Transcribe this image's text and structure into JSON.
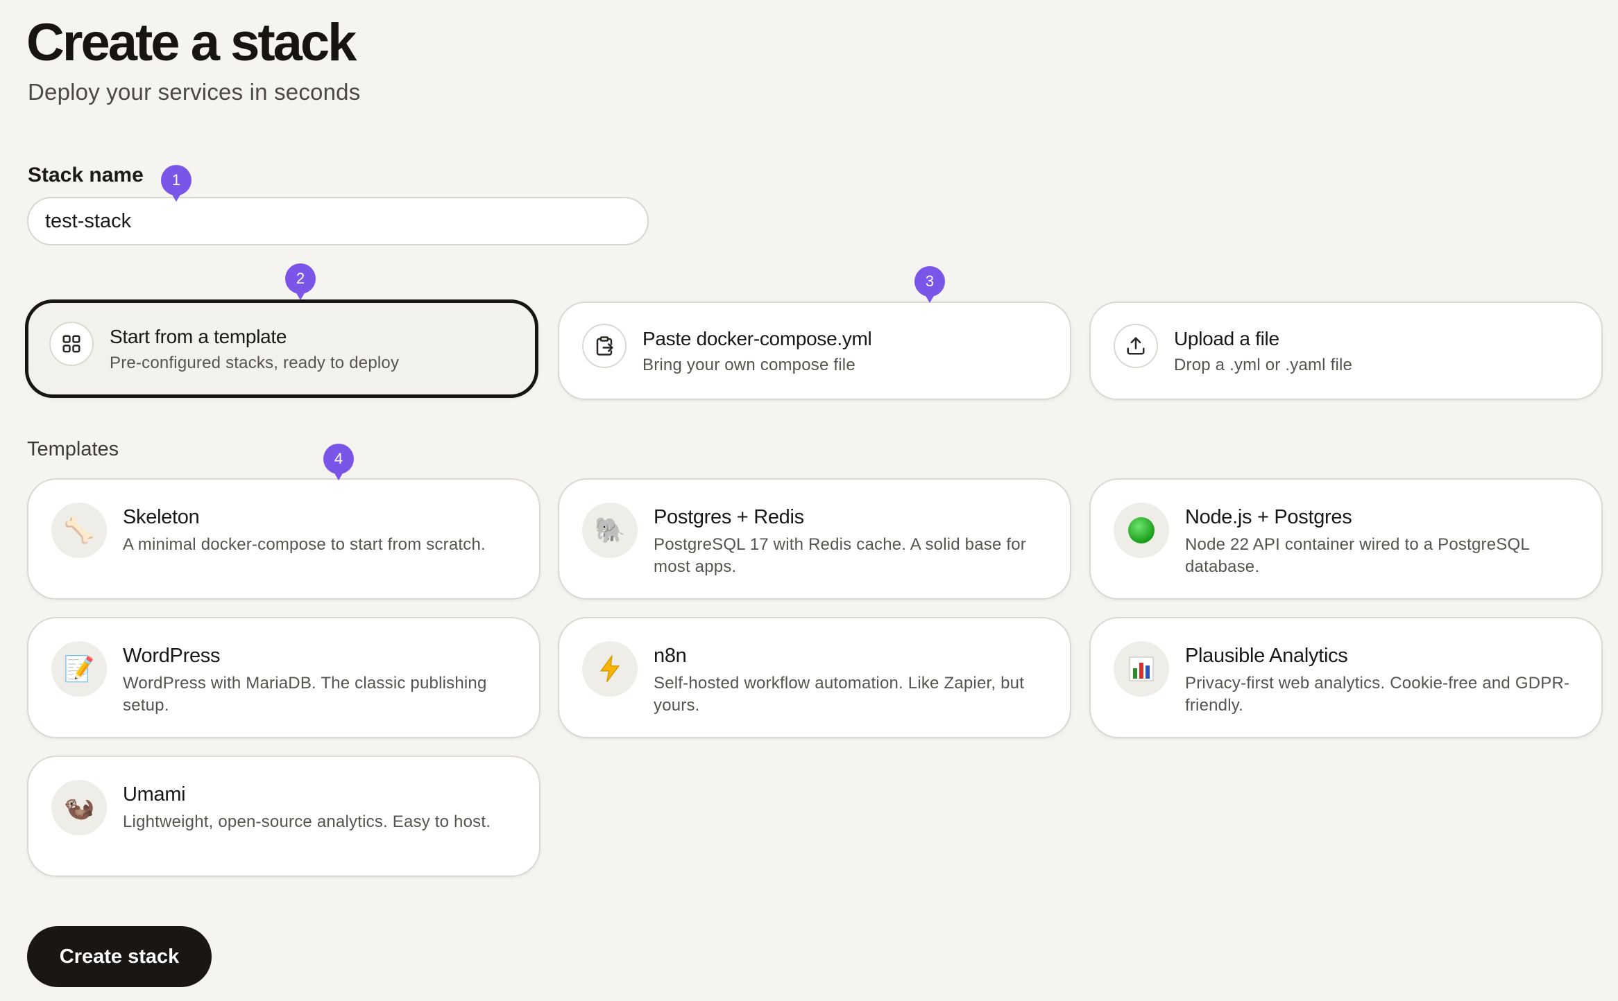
{
  "header": {
    "title": "Create a stack",
    "subtitle": "Deploy your services in seconds"
  },
  "stack_name": {
    "label": "Stack name",
    "value": "test-stack"
  },
  "source_options": [
    {
      "title": "Start from a template",
      "description": "Pre-configured stacks, ready to deploy",
      "icon": "grid-icon",
      "selected": true
    },
    {
      "title": "Paste docker-compose.yml",
      "description": "Bring your own compose file",
      "icon": "clipboard-paste-icon",
      "selected": false
    },
    {
      "title": "Upload a file",
      "description": "Drop a .yml or .yaml file",
      "icon": "upload-icon",
      "selected": false
    }
  ],
  "templates_label": "Templates",
  "templates": [
    {
      "name": "Skeleton",
      "description": "A minimal docker-compose to start from scratch.",
      "icon": "bone-icon",
      "glyph": "🦴"
    },
    {
      "name": "Postgres + Redis",
      "description": "PostgreSQL 17 with Redis cache. A solid base for most apps.",
      "icon": "elephant-icon",
      "glyph": "🐘"
    },
    {
      "name": "Node.js + Postgres",
      "description": "Node 22 API container wired to a PostgreSQL database.",
      "icon": "green-circle-icon",
      "glyph": ""
    },
    {
      "name": "WordPress",
      "description": "WordPress with MariaDB. The classic publishing setup.",
      "icon": "memo-icon",
      "glyph": "📝"
    },
    {
      "name": "n8n",
      "description": "Self-hosted workflow automation. Like Zapier, but yours.",
      "icon": "lightning-icon",
      "glyph": "⚡"
    },
    {
      "name": "Plausible Analytics",
      "description": "Privacy-first web analytics. Cookie-free and GDPR-friendly.",
      "icon": "bar-chart-icon",
      "glyph": ""
    },
    {
      "name": "Umami",
      "description": "Lightweight, open-source analytics. Easy to host.",
      "icon": "otter-icon",
      "glyph": "🦦"
    }
  ],
  "create_button_label": "Create stack",
  "markers": [
    "1",
    "2",
    "3",
    "4"
  ],
  "colors": {
    "background": "#f5f4f0",
    "accent_dark": "#1a1613",
    "marker": "#7b55e8",
    "node_green": "#22b022"
  }
}
